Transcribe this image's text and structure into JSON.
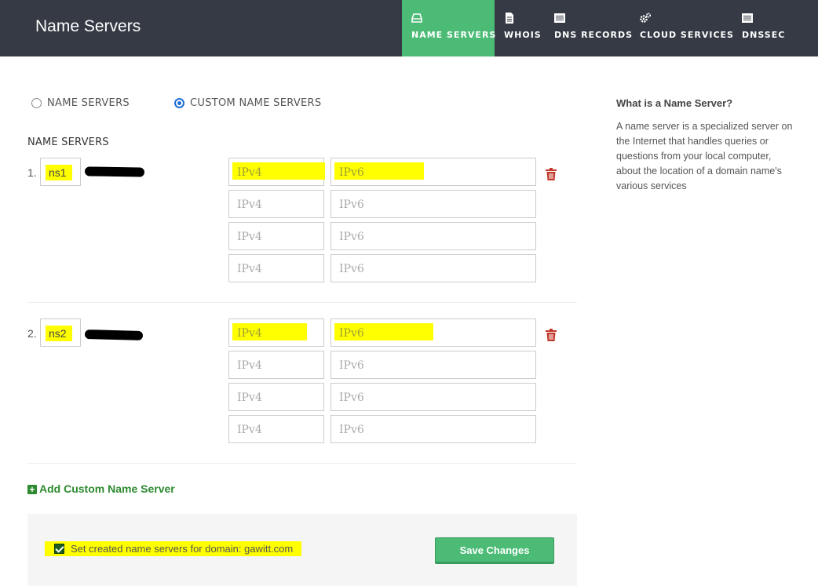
{
  "header": {
    "title": "Name Servers",
    "tabs": [
      {
        "label": "NAME SERVERS",
        "icon": "hard-drive-icon",
        "active": true
      },
      {
        "label": "WHOIS",
        "icon": "document-icon",
        "active": false
      },
      {
        "label": "DNS RECORDS",
        "icon": "list-icon",
        "active": false
      },
      {
        "label": "CLOUD SERVICES",
        "icon": "gears-icon",
        "active": false
      },
      {
        "label": "DNSSEC",
        "icon": "list-icon",
        "active": false
      }
    ]
  },
  "mode": {
    "options": [
      {
        "label": "NAME SERVERS",
        "selected": false
      },
      {
        "label": "CUSTOM NAME SERVERS",
        "selected": true
      }
    ]
  },
  "name_servers": {
    "heading": "NAME SERVERS",
    "entries": [
      {
        "index": "1.",
        "prefix": "ns1",
        "ipv4_placeholder": "IPv4",
        "ipv6_placeholder": "IPv6"
      },
      {
        "index": "2.",
        "prefix": "ns2",
        "ipv4_placeholder": "IPv4",
        "ipv6_placeholder": "IPv6"
      }
    ]
  },
  "add_custom_label": "Add Custom Name Server",
  "footer": {
    "checkbox_label": "Set created name servers for domain: gawitt.com",
    "checkbox_checked": true,
    "save_label": "Save Changes"
  },
  "aside": {
    "title": "What is a Name Server?",
    "body": "A name server is a specialized server on the Internet that handles queries or questions from your local computer, about the location of a domain name's various services"
  },
  "colors": {
    "topbar": "#353a44",
    "accent_green": "#4cbb76",
    "radio_blue": "#1d6ed6",
    "delete_red": "#c0392b",
    "link_green": "#2d8a2f",
    "highlight": "#ffff00"
  }
}
